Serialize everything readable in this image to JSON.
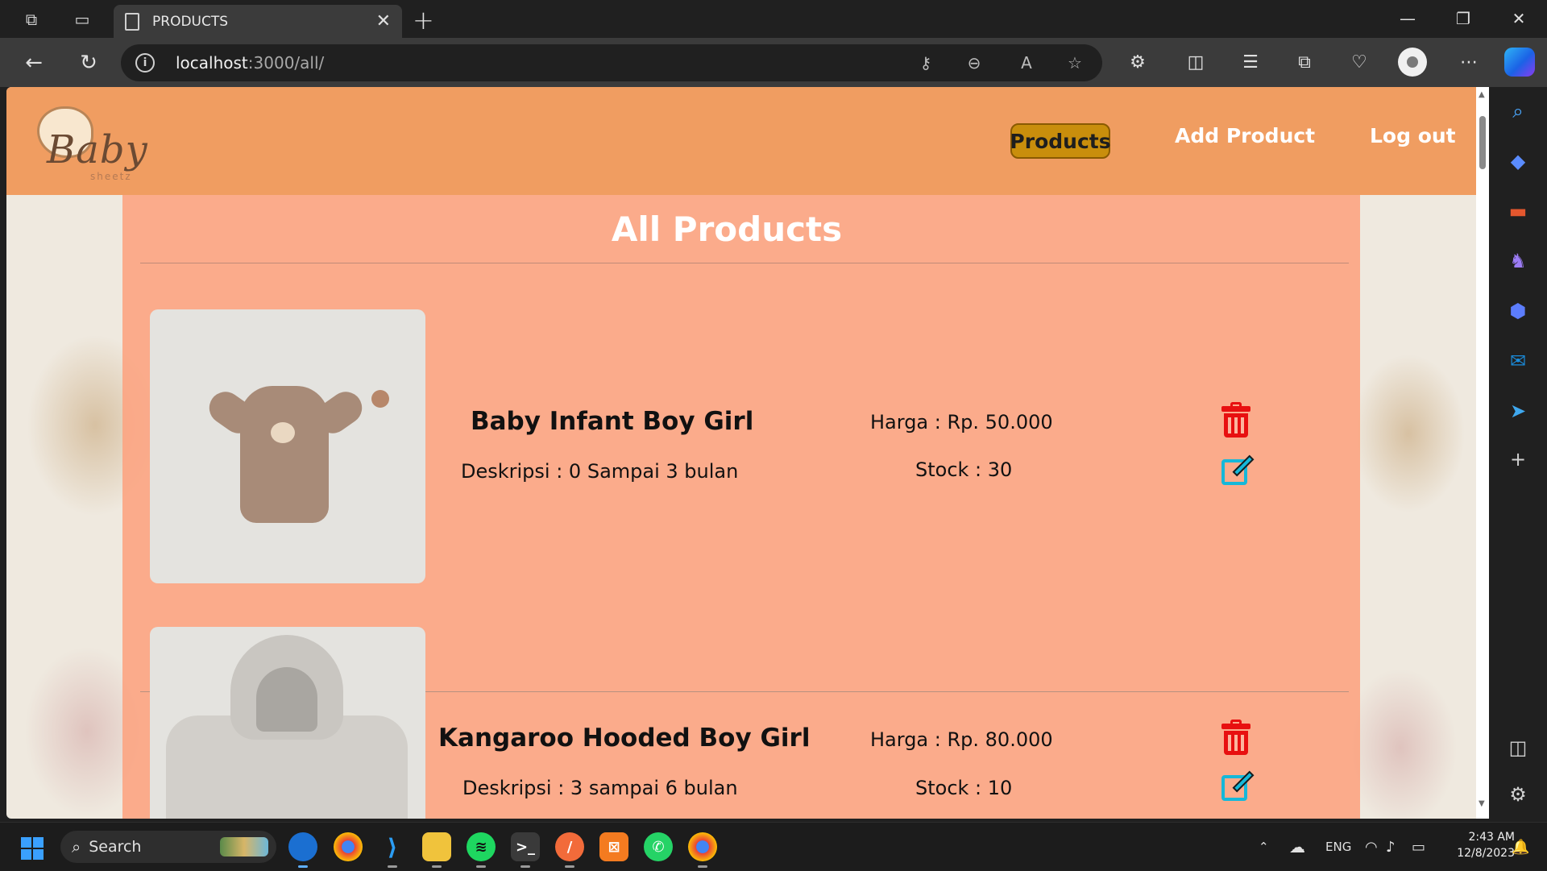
{
  "browser": {
    "tab_title": "PRODUCTS",
    "tab_close": "✕",
    "new_tab": "+",
    "url_host": "localhost",
    "url_path": ":3000/all/"
  },
  "site": {
    "logo_text": "Baby",
    "logo_sub": "sheetz",
    "nav": {
      "products": "Products",
      "add_product": "Add Product",
      "logout": "Log out"
    },
    "page_title": "All Products",
    "products": [
      {
        "name": "Baby Infant Boy Girl",
        "desc": "Deskripsi : 0 Sampai 3 bulan",
        "price": "Harga : Rp. 50.000",
        "stock": "Stock : 30"
      },
      {
        "name": "Kangaroo Hooded Boy Girl",
        "desc": "Deskripsi : 3 sampai 6 bulan",
        "price": "Harga : Rp. 80.000",
        "stock": "Stock : 10"
      }
    ]
  },
  "taskbar": {
    "search_label": "Search",
    "language": "ENG",
    "time": "2:43 AM",
    "date": "12/8/2023"
  },
  "colors": {
    "header": "#f0964f",
    "panel": "#fca482",
    "nav_active": "#c98e0c",
    "delete": "#e81010",
    "edit": "#15b8d9"
  }
}
